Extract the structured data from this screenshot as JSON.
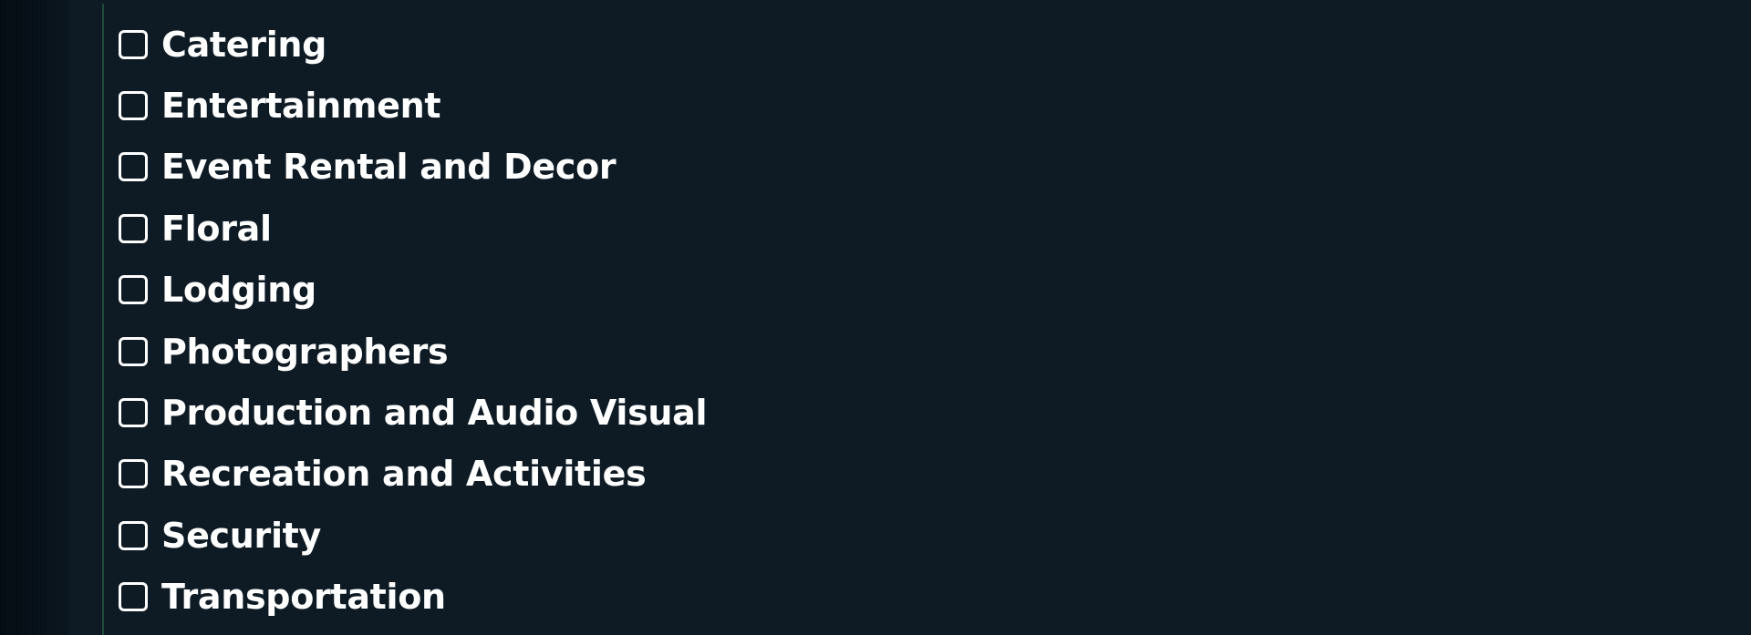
{
  "filters": {
    "items": [
      {
        "label": "Catering",
        "checked": false
      },
      {
        "label": "Entertainment",
        "checked": false
      },
      {
        "label": "Event Rental and Decor",
        "checked": false
      },
      {
        "label": "Floral",
        "checked": false
      },
      {
        "label": "Lodging",
        "checked": false
      },
      {
        "label": "Photographers",
        "checked": false
      },
      {
        "label": "Production and Audio Visual",
        "checked": false
      },
      {
        "label": "Recreation and Activities",
        "checked": false
      },
      {
        "label": "Security",
        "checked": false
      },
      {
        "label": "Transportation",
        "checked": false
      }
    ]
  },
  "colors": {
    "background": "#0e1b25",
    "gutter": "#050d14",
    "accent_line": "#1f4a3c",
    "text": "#ffffff"
  }
}
